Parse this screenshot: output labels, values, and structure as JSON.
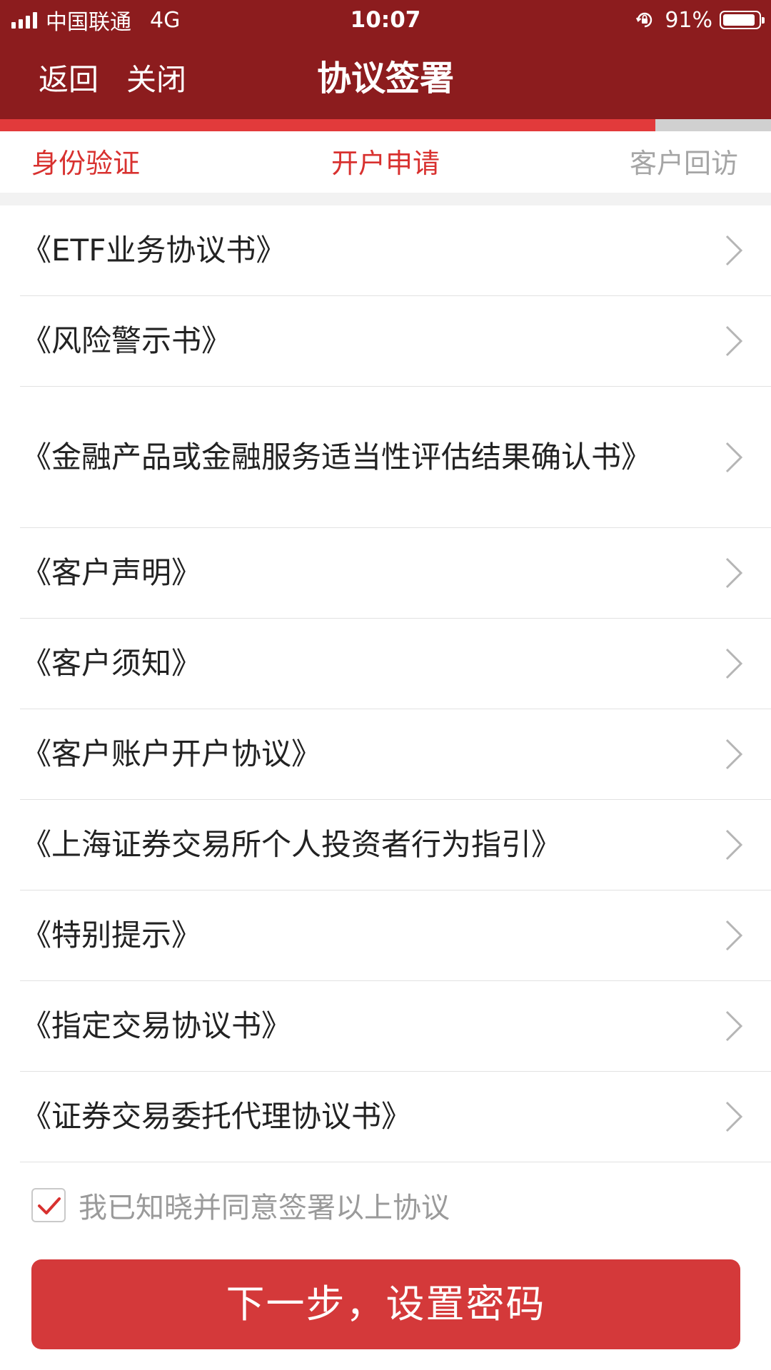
{
  "status_bar": {
    "carrier": "中国联通",
    "network": "4G",
    "time": "10:07",
    "battery": "91%",
    "battery_level": 0.91
  },
  "nav": {
    "back_label": "返回",
    "close_label": "关闭",
    "title": "协议签署"
  },
  "progress": {
    "value": 0.85,
    "fill_color": "#e23a3b",
    "track_color": "#d0d0d0"
  },
  "steps": [
    {
      "label": "身份验证",
      "state": "done"
    },
    {
      "label": "开户申请",
      "state": "active"
    },
    {
      "label": "客户回访",
      "state": "pending"
    }
  ],
  "agreements": [
    {
      "label": "《ETF业务协议书》"
    },
    {
      "label": "《风险警示书》"
    },
    {
      "label": "《金融产品或金融服务适当性评估结果确认书》"
    },
    {
      "label": "《客户声明》"
    },
    {
      "label": "《客户须知》"
    },
    {
      "label": "《客户账户开户协议》"
    },
    {
      "label": "《上海证券交易所个人投资者行为指引》"
    },
    {
      "label": "《特别提示》"
    },
    {
      "label": "《指定交易协议书》"
    },
    {
      "label": "《证券交易委托代理协议书》"
    }
  ],
  "agree": {
    "label": "我已知晓并同意签署以上协议",
    "checked": true
  },
  "next_button": {
    "label": "下一步，设置密码"
  },
  "colors": {
    "header_bg": "#8c1c1e",
    "accent": "#d8312f",
    "button_bg": "#d4393a",
    "inactive_text": "#a5a5a5"
  }
}
